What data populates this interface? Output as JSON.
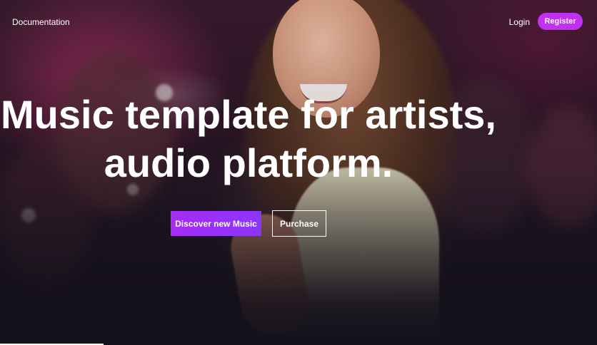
{
  "header": {
    "documentation_label": "Documentation",
    "login_label": "Login",
    "register_label": "Register"
  },
  "hero": {
    "headline_line_1": "Music template for artists,",
    "headline_line_2": "audio platform."
  },
  "buttons": {
    "discover_label": "Discover new Music",
    "purchase_label": "Purchase"
  },
  "colors": {
    "accent": "#c231f3",
    "accent_gradient_end": "#8c35ff",
    "background": "#15121d",
    "text": "#ffffff"
  }
}
